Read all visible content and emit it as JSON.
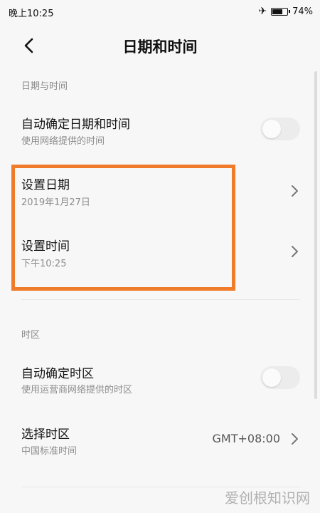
{
  "status_bar": {
    "time": "晚上10:25",
    "airplane_icon": "airplane-icon",
    "battery_percent": "74%",
    "battery_level": 0.74
  },
  "header": {
    "back_icon": "back-arrow-icon",
    "title": "日期和时间"
  },
  "date_time_section": {
    "label": "日期与时间",
    "auto_time": {
      "title": "自动确定日期和时间",
      "subtitle": "使用网络提供的时间",
      "enabled": false
    },
    "set_date": {
      "title": "设置日期",
      "value": "2019年1月27日"
    },
    "set_time": {
      "title": "设置时间",
      "value": "下午10:25"
    }
  },
  "timezone_section": {
    "label": "时区",
    "auto_timezone": {
      "title": "自动确定时区",
      "subtitle": "使用运营商网络提供的时区",
      "enabled": false
    },
    "select_timezone": {
      "title": "选择时区",
      "subtitle": "中国标准时间",
      "value": "GMT+08:00"
    }
  },
  "colors": {
    "highlight": "#f07b2a",
    "background": "#f7f7f7"
  },
  "watermark": "爱创根知识网"
}
